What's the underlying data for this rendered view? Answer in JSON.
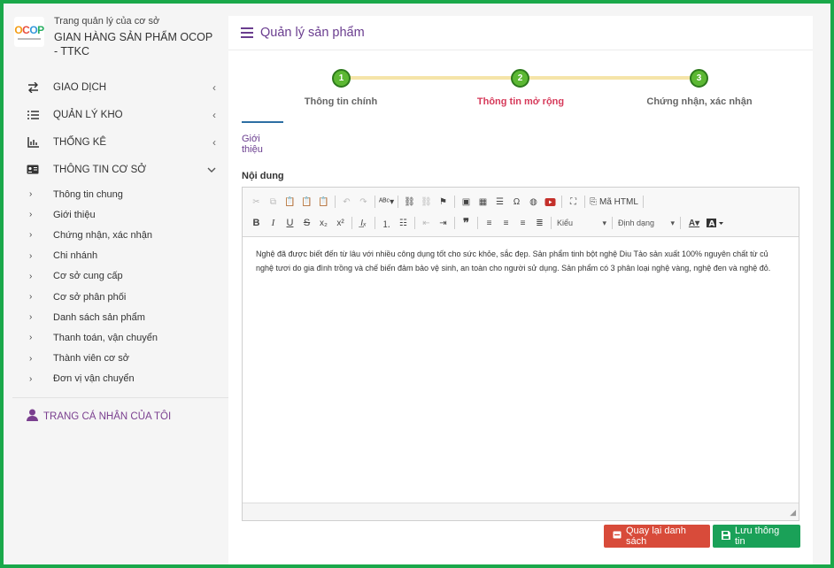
{
  "brand": {
    "logo_text": "OCOP",
    "subtitle": "Trang quản lý của cơ sở",
    "name": "GIAN HÀNG SẢN PHẨM OCOP - TTKC"
  },
  "menu": [
    {
      "label": "GIAO DỊCH",
      "icon": "swap-icon",
      "chevron": "‹"
    },
    {
      "label": "QUẢN LÝ KHO",
      "icon": "list-icon",
      "chevron": "‹"
    },
    {
      "label": "THỐNG KÊ",
      "icon": "bar-chart-icon",
      "chevron": "‹"
    },
    {
      "label": "THÔNG TIN CƠ SỞ",
      "icon": "id-card-icon",
      "chevron": "⌄"
    }
  ],
  "submenu": [
    "Thông tin chung",
    "Giới thiệu",
    "Chứng nhận, xác nhận",
    "Chi nhánh",
    "Cơ sở cung cấp",
    "Cơ sở phân phối",
    "Danh sách sản phẩm",
    "Thanh toán, vận chuyển",
    "Thành viên cơ sở",
    "Đơn vị vận chuyển"
  ],
  "profile_label": "TRANG CÁ NHÂN CỦA TÔI",
  "page_title": "Quản lý sản phẩm",
  "steps": [
    {
      "number": "1",
      "label": "Thông tin chính"
    },
    {
      "number": "2",
      "label": "Thông tin mở rộng"
    },
    {
      "number": "3",
      "label": "Chứng nhận, xác nhận"
    }
  ],
  "tab_label": "Giới thiệu",
  "field_label": "Nội dung",
  "editor": {
    "source_label": "Mã HTML",
    "style_combo": "Kiểu",
    "format_combo": "Định dạng",
    "content": "Nghệ đã được biết đến từ lâu với nhiều công dụng tốt cho sức khỏe, sắc đẹp. Sản phẩm tinh bột nghệ Diu Tảo sản xuất 100% nguyên chất từ củ nghệ tươi do gia đình trồng và chế biến đảm bảo vệ sinh, an toàn cho người sử dụng. Sản phẩm có 3 phân loại nghệ vàng, nghệ đen và nghệ đỏ."
  },
  "buttons": {
    "back": "Quay lại danh sách",
    "save": "Lưu thông tin"
  },
  "colors": {
    "frame": "#1aa84a",
    "accent": "#6a3d8f",
    "step_done": "#5cb833",
    "step_active_label": "#d63a5a",
    "btn_back": "#d84b3a",
    "btn_save": "#1aa158"
  }
}
